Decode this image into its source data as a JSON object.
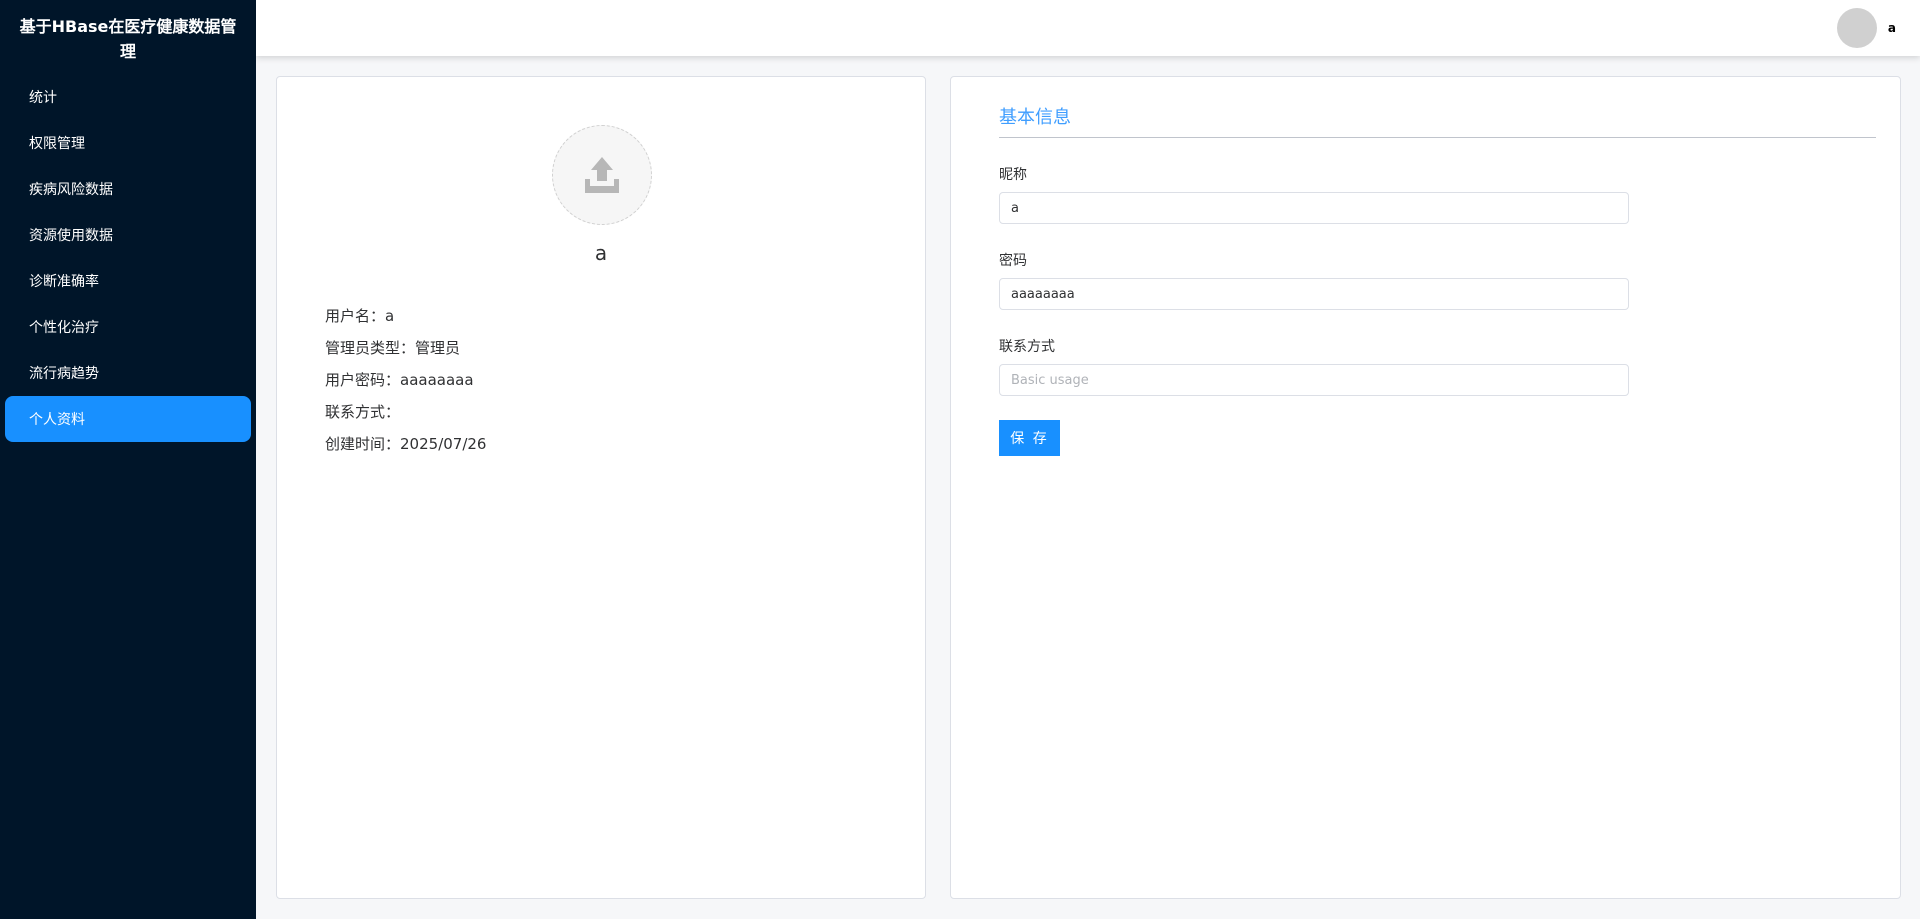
{
  "app": {
    "title": "基于HBase在医疗健康数据管理"
  },
  "sidebar": {
    "items": [
      {
        "label": "统计"
      },
      {
        "label": "权限管理"
      },
      {
        "label": "疾病风险数据"
      },
      {
        "label": "资源使用数据"
      },
      {
        "label": "诊断准确率"
      },
      {
        "label": "个性化治疗"
      },
      {
        "label": "流行病趋势"
      },
      {
        "label": "个人资料",
        "active": true
      }
    ]
  },
  "header": {
    "username": "a"
  },
  "profile": {
    "name": "a",
    "rows": [
      {
        "label": "用户名：",
        "value": "a"
      },
      {
        "label": "管理员类型：",
        "value": "管理员"
      },
      {
        "label": "用户密码：",
        "value": "aaaaaaaa"
      },
      {
        "label": "联系方式：",
        "value": ""
      },
      {
        "label": "创建时间：",
        "value": "2025/07/26"
      }
    ]
  },
  "form": {
    "title": "基本信息",
    "fields": [
      {
        "label": "昵称",
        "value": "a",
        "placeholder": ""
      },
      {
        "label": "密码",
        "value": "aaaaaaaa",
        "placeholder": ""
      },
      {
        "label": "联系方式",
        "value": "",
        "placeholder": "Basic usage"
      }
    ],
    "save_label": "保 存"
  },
  "colors": {
    "sidebar_bg": "#001529",
    "accent": "#1890ff",
    "title_blue": "#409eff"
  }
}
